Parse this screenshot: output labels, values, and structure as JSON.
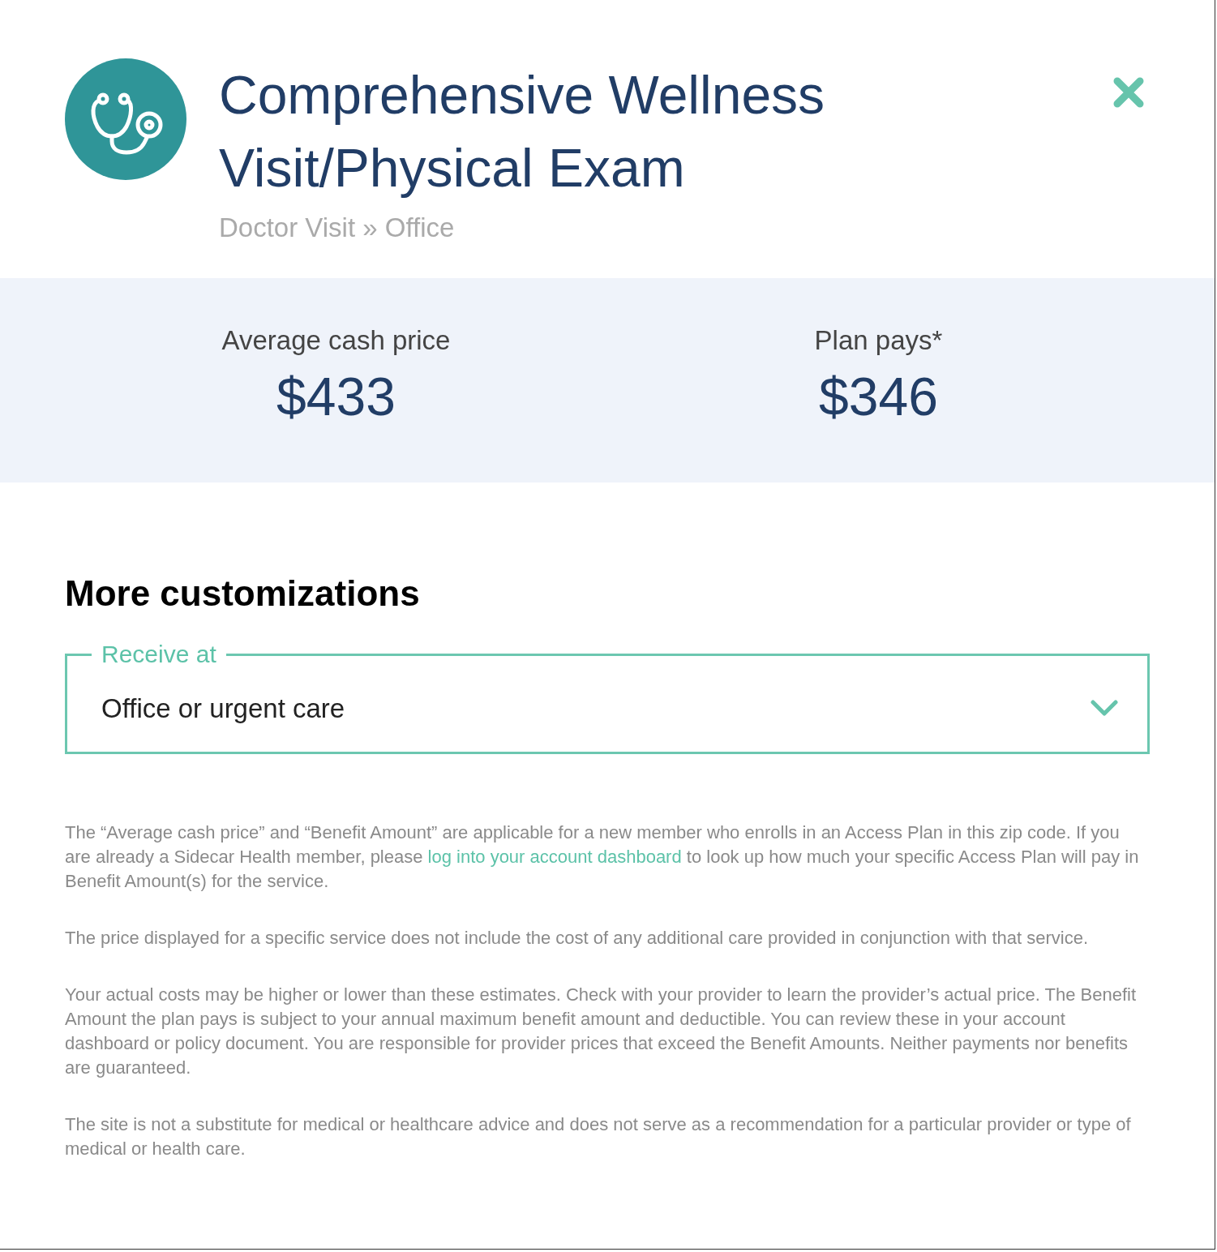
{
  "header": {
    "title": "Comprehensive Wellness Visit/Physical Exam",
    "breadcrumb": "Doctor Visit » Office"
  },
  "prices": [
    {
      "label": "Average cash price",
      "value": "$433"
    },
    {
      "label": "Plan pays*",
      "value": "$346"
    }
  ],
  "customizations": {
    "heading": "More customizations",
    "select": {
      "label": "Receive at",
      "value": "Office or urgent care"
    }
  },
  "disclaimers": [
    [
      {
        "kind": "text",
        "text": "The “Average cash price” and “Benefit Amount” are applicable for a new member who enrolls in an Access Plan in this zip code. If you are already a Sidecar Health member, please "
      },
      {
        "kind": "link",
        "text": "log into your account dashboard"
      },
      {
        "kind": "text",
        "text": " to look up how much your specific Access Plan will pay in Benefit Amount(s) for the service."
      }
    ],
    [
      {
        "kind": "text",
        "text": "The price displayed for a specific service does not include the cost of any additional care provided in conjunction with that service."
      }
    ],
    [
      {
        "kind": "text",
        "text": "Your actual costs may be higher or lower than these estimates. Check with your provider to learn the provider’s actual price. The Benefit Amount the plan pays is subject to your annual maximum benefit amount and deductible. You can review these in your account dashboard or policy document. You are responsible for provider prices that exceed the Benefit Amounts. Neither payments nor benefits are guaranteed."
      }
    ],
    [
      {
        "kind": "text",
        "text": "The site is not a substitute for medical or healthcare advice and does not serve as a recommendation for a particular provider or type of medical or health care."
      }
    ]
  ]
}
